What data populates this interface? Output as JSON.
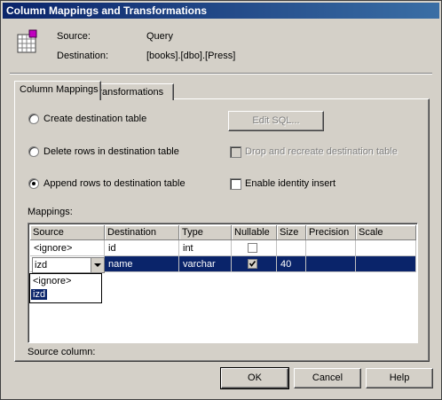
{
  "window": {
    "title": "Column Mappings and Transformations"
  },
  "info": {
    "source_label": "Source:",
    "source_value": "Query",
    "destination_label": "Destination:",
    "destination_value": "[books].[dbo].[Press]",
    "icon": "table-icon"
  },
  "tabs": [
    {
      "label": "Column Mappings",
      "active": true
    },
    {
      "label": "Transformations",
      "active": false
    }
  ],
  "options": {
    "create_table": {
      "label": "Create destination table",
      "selected": false
    },
    "delete_rows": {
      "label": "Delete rows in destination table",
      "selected": false
    },
    "append_rows": {
      "label": "Append rows to destination table",
      "selected": true
    },
    "edit_sql": "Edit SQL...",
    "drop_recreate": {
      "label": "Drop and recreate destination table",
      "checked": false,
      "enabled": false
    },
    "identity_insert": {
      "label": "Enable identity insert",
      "checked": false
    }
  },
  "mappings": {
    "label": "Mappings:",
    "columns": [
      "Source",
      "Destination",
      "Type",
      "Nullable",
      "Size",
      "Precision",
      "Scale"
    ],
    "rows": [
      {
        "source": "<ignore>",
        "destination": "id",
        "type": "int",
        "nullable": false,
        "size": "",
        "precision": "",
        "scale": ""
      },
      {
        "source": "izd",
        "destination": "name",
        "type": "varchar",
        "nullable": true,
        "size": "40",
        "precision": "",
        "scale": ""
      }
    ],
    "dropdown_options": [
      "<ignore>",
      "izd"
    ],
    "dropdown_selected": "izd"
  },
  "source_column_label": "Source column:",
  "buttons": {
    "ok": "OK",
    "cancel": "Cancel",
    "help": "Help"
  },
  "colors": {
    "title_bar": "#0a246a",
    "selection": "#0a246a",
    "face": "#d4d0c8"
  }
}
